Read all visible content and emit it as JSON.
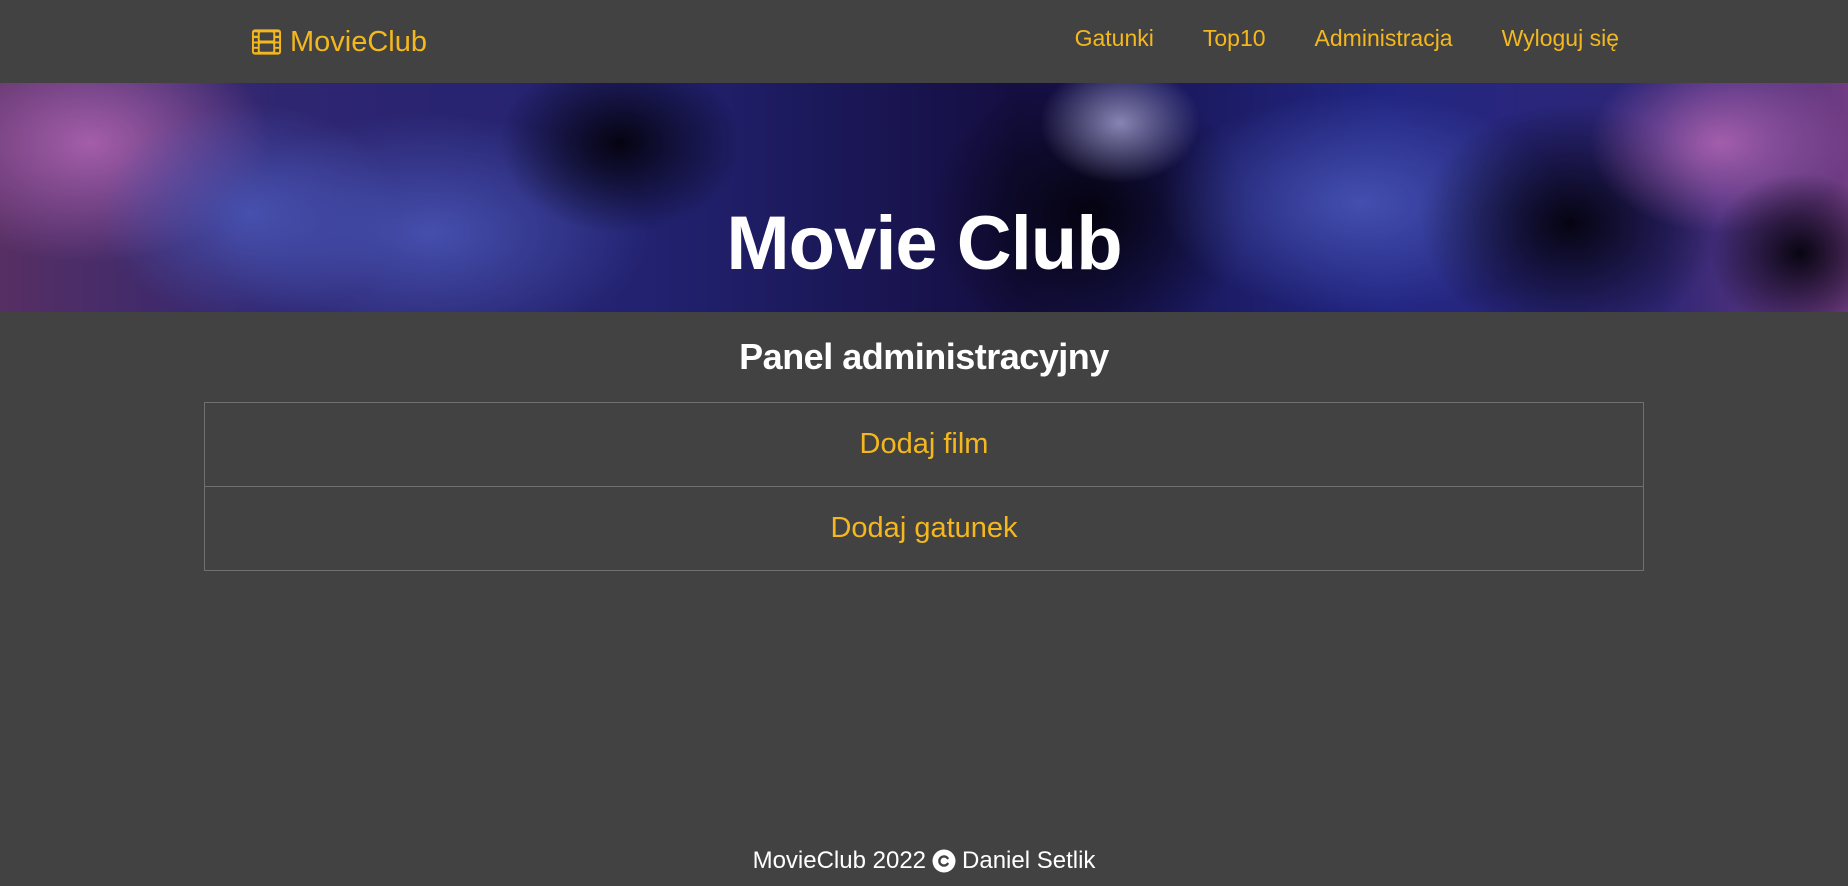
{
  "navbar": {
    "brand_label": "MovieClub",
    "brand_icon": "film-icon",
    "links": [
      {
        "label": "Gatunki"
      },
      {
        "label": "Top10"
      },
      {
        "label": "Administracja"
      },
      {
        "label": "Wyloguj się"
      }
    ]
  },
  "hero": {
    "title": "Movie Club"
  },
  "admin_panel": {
    "title": "Panel administracyjny",
    "items": [
      {
        "label": "Dodaj film"
      },
      {
        "label": "Dodaj gatunek"
      }
    ]
  },
  "footer": {
    "text_before": "MovieClub 2022",
    "icon": "copyright-icon",
    "text_after": "Daniel Setlik"
  },
  "colors": {
    "background": "#424242",
    "accent": "#f4b81e",
    "text": "#ffffff",
    "border": "#6f6f6f"
  }
}
